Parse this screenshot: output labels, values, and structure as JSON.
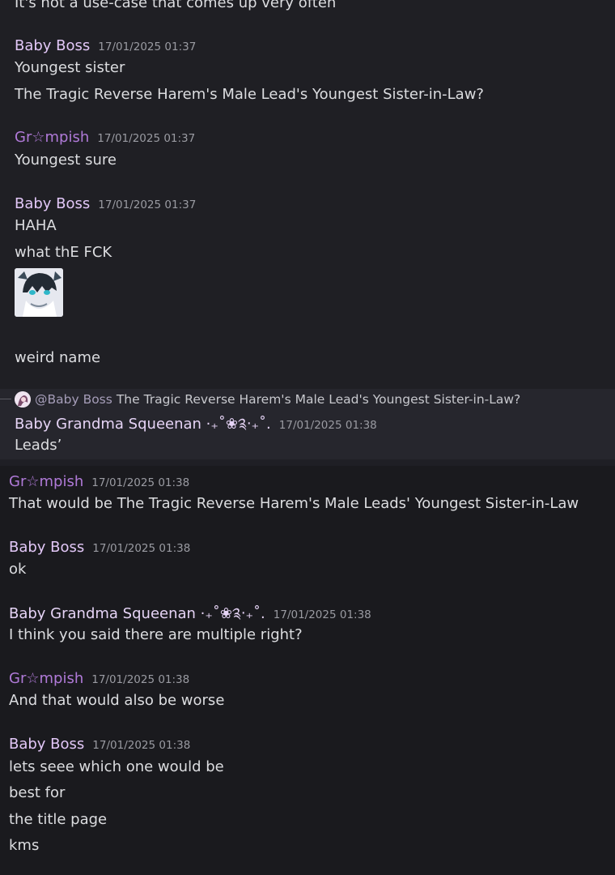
{
  "timestamp": "17/01/2025 01:37",
  "timestamp2": "17/01/2025 01:38",
  "users": {
    "baby_boss": "Baby Boss",
    "grumpish": "Gr☆mpish",
    "squeenan": "Baby Grandma Squeenan ·₊˚❀༉‧₊˚."
  },
  "messages": {
    "m0": "It's not a use-case that comes up very often",
    "m1a": "Youngest sister",
    "m1b": "The Tragic Reverse Harem's Male Lead's Youngest Sister-in-Law?",
    "m2a": "Youngest sure",
    "m3a": "HAHA",
    "m3b": "what thE FCK",
    "m3c": "weird name",
    "reply_mention": "@Baby Boss",
    "reply_text": "The Tragic Reverse Harem's Male Lead's Youngest Sister-in-Law?",
    "m4a": "Leads’",
    "m5a": "That would be The Tragic Reverse Harem's Male Leads' Youngest Sister-in-Law",
    "m6a": "ok",
    "m7a": "I think you said there are multiple right?",
    "m8a": "And that would also be worse",
    "m9a": "lets seee which one would be",
    "m9b": "best for",
    "m9c": "the title page",
    "m9d": "kms"
  },
  "icons": {
    "thumbnail": "sticker-image",
    "reply_avatar": "user-avatar"
  }
}
